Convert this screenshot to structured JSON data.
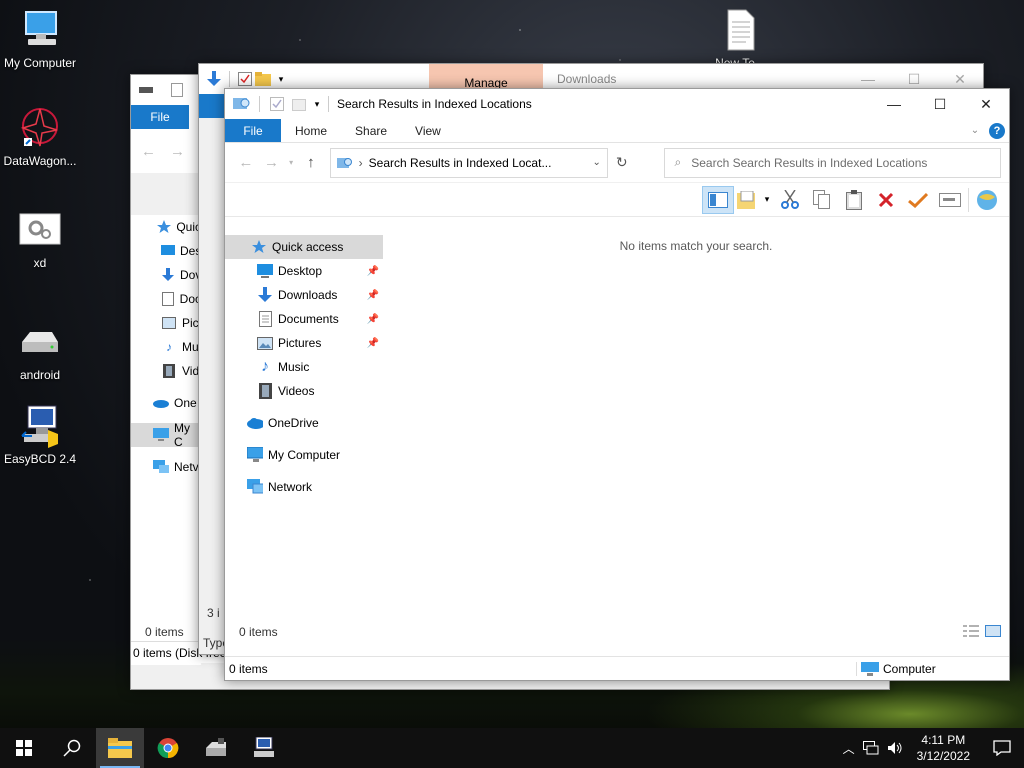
{
  "desktop": {
    "icons": [
      {
        "label": "My Computer"
      },
      {
        "label": "DataWagon..."
      },
      {
        "label": "xd"
      },
      {
        "label": "android"
      },
      {
        "label": "EasyBCD 2.4"
      }
    ],
    "partial_icon_label": "New Te..."
  },
  "back_window": {
    "tab_file": "File",
    "nav": [
      "Quic",
      "Des",
      "Dov",
      "Doc",
      "Pic",
      "Mu",
      "Vid",
      "One",
      "My C",
      "Netv"
    ],
    "status_items": "0 items",
    "status_bar": "0 items (Disk free"
  },
  "mid_window": {
    "context_tab": "Manage",
    "title": "Downloads",
    "tab_file": "F",
    "status_items": "3 i",
    "type_label": "Type"
  },
  "main_window": {
    "title": "Search Results in Indexed Locations",
    "tabs": {
      "file": "File",
      "home": "Home",
      "share": "Share",
      "view": "View"
    },
    "address": "Search Results in Indexed Locat...",
    "search_placeholder": "Search Search Results in Indexed Locations",
    "empty_message": "No items match your search.",
    "nav": {
      "quick_access": "Quick access",
      "desktop": "Desktop",
      "downloads": "Downloads",
      "documents": "Documents",
      "pictures": "Pictures",
      "music": "Music",
      "videos": "Videos",
      "onedrive": "OneDrive",
      "my_computer": "My Computer",
      "network": "Network"
    },
    "status_items": "0 items",
    "statusbar_items": "0 items",
    "statusbar_location": "Computer"
  },
  "taskbar": {
    "time": "4:11 PM",
    "date": "3/12/2022"
  },
  "colors": {
    "accent": "#1979ca",
    "manage_tab": "#f6c6b0",
    "taskbar": "#101010"
  }
}
